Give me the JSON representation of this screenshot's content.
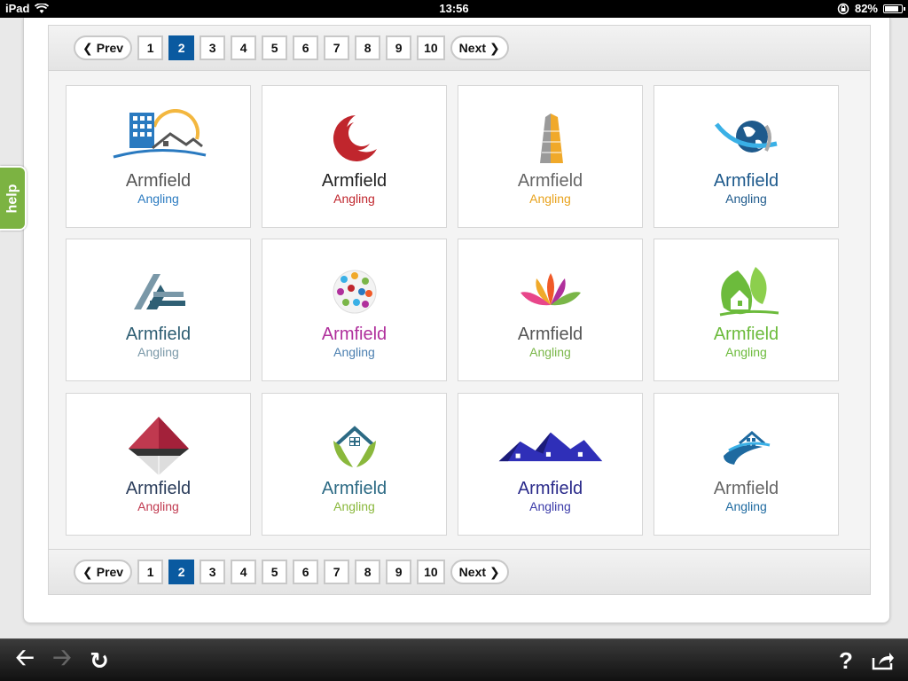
{
  "status": {
    "device": "iPad",
    "time": "13:56",
    "battery": "82%",
    "battery_level": 0.82
  },
  "pagination": {
    "prev": "Prev",
    "next": "Next",
    "pages": [
      "1",
      "2",
      "3",
      "4",
      "5",
      "6",
      "7",
      "8",
      "9",
      "10"
    ],
    "active": "2"
  },
  "help": {
    "label": "help"
  },
  "logos": [
    {
      "brand": "Armfield",
      "tagline": "Angling",
      "icon": "city-sun-building-icon",
      "brand_color": "#555555",
      "tag_color": "#2a7ac0"
    },
    {
      "brand": "Armfield",
      "tagline": "Angling",
      "icon": "red-crescent-swirl-icon",
      "brand_color": "#222222",
      "tag_color": "#c0262d"
    },
    {
      "brand": "Armfield",
      "tagline": "Angling",
      "icon": "gold-tower-icon",
      "brand_color": "#666666",
      "tag_color": "#e8a21c"
    },
    {
      "brand": "Armfield",
      "tagline": "Angling",
      "icon": "globe-swoosh-icon",
      "brand_color": "#1e5a8c",
      "tag_color": "#1e5a8c"
    },
    {
      "brand": "Armfield",
      "tagline": "Angling",
      "icon": "triangle-stripes-icon",
      "brand_color": "#2f5f74",
      "tag_color": "#7a98a8"
    },
    {
      "brand": "Armfield",
      "tagline": "Angling",
      "icon": "people-globe-icon",
      "brand_color": "#b0309c",
      "tag_color": "#4b7fb0"
    },
    {
      "brand": "Armfield",
      "tagline": "Angling",
      "icon": "lotus-flower-icon",
      "brand_color": "#555555",
      "tag_color": "#7ab648"
    },
    {
      "brand": "Armfield",
      "tagline": "Angling",
      "icon": "green-leaf-house-icon",
      "brand_color": "#6cbb3c",
      "tag_color": "#6cbb3c"
    },
    {
      "brand": "Armfield",
      "tagline": "Angling",
      "icon": "diamond-pyramid-icon",
      "brand_color": "#2c3e5c",
      "tag_color": "#c0394f"
    },
    {
      "brand": "Armfield",
      "tagline": "Angling",
      "icon": "house-hands-icon",
      "brand_color": "#2c6a84",
      "tag_color": "#8ab83c"
    },
    {
      "brand": "Armfield",
      "tagline": "Angling",
      "icon": "blue-rooftops-icon",
      "brand_color": "#2a2a8a",
      "tag_color": "#3a3aa8"
    },
    {
      "brand": "Armfield",
      "tagline": "Angling",
      "icon": "house-swoosh-icon",
      "brand_color": "#666666",
      "tag_color": "#1e6aa0"
    }
  ]
}
